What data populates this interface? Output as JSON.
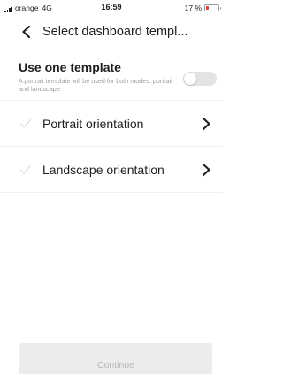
{
  "status_bar": {
    "carrier": "orange",
    "network": "4G",
    "time": "16:59",
    "battery_text": "17 %",
    "battery_level": 0.17,
    "battery_color": "#e53935"
  },
  "header": {
    "back_icon": "chevron-left-icon",
    "title": "Select dashboard templ..."
  },
  "template_option": {
    "title": "Use one template",
    "description": "A portrait template will be used for both modes: portrait and landscape.",
    "enabled": false
  },
  "orientations": [
    {
      "label": "Portrait orientation",
      "check_icon": "check-icon",
      "chevron_icon": "chevron-right-icon"
    },
    {
      "label": "Landscape orientation",
      "check_icon": "check-icon",
      "chevron_icon": "chevron-right-icon"
    }
  ],
  "footer": {
    "continue_label": "Continue",
    "continue_enabled": false
  },
  "colors": {
    "text": "#1f1f1f",
    "muted_text": "#9c9c9c",
    "disabled_button_bg": "#ececec",
    "disabled_button_text": "#b7b7b7",
    "toggle_off": "#e3e3e3"
  }
}
